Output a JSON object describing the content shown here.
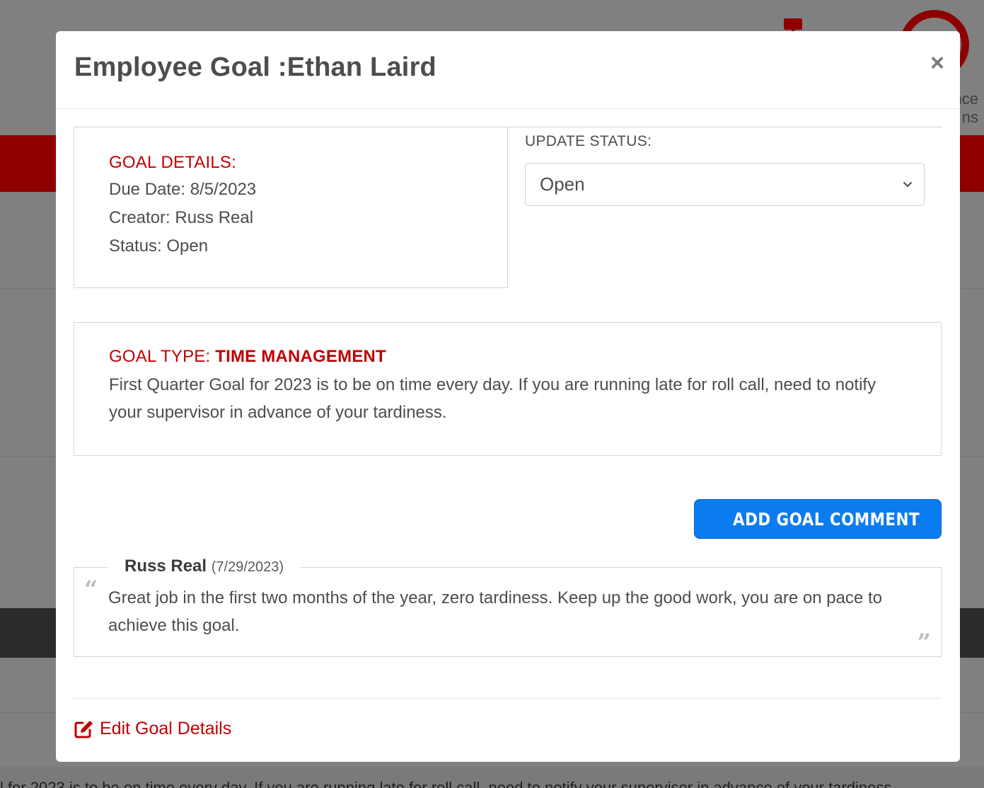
{
  "background": {
    "nav_text_line1": "nce",
    "nav_text_line2": "ns",
    "bottom_text": "l for 2023 is to be on time every day. If you are running late for roll call, need to notify your supervisor in advance of your tardiness."
  },
  "modal": {
    "title": "Employee Goal :Ethan Laird",
    "close_symbol": "×",
    "goal_details": {
      "heading": "GOAL DETAILS:",
      "due_date": "Due Date: 8/5/2023",
      "creator": "Creator: Russ Real",
      "status": "Status: Open"
    },
    "update_status": {
      "label": "UPDATE STATUS:",
      "selected": "Open"
    },
    "goal_type": {
      "label": "GOAL TYPE: ",
      "value": "TIME MANAGEMENT",
      "description": "First Quarter Goal for 2023 is to be on time every day. If you are running late for roll call, need to notify your supervisor in advance of your tardiness."
    },
    "add_comment_button": "ADD GOAL COMMENT",
    "comment": {
      "author": "Russ Real",
      "date": "(7/29/2023)",
      "text": "Great job in the first two months of the year, zero tardiness. Keep up the good work, you are on pace to achieve this goal.",
      "open_quote": "“",
      "close_quote": "”"
    },
    "edit_link": "Edit Goal Details"
  },
  "colors": {
    "accent_red": "#c00000",
    "button_blue": "#0a7cf0",
    "overlay_gray": "#808080"
  },
  "icons": [
    "close-icon",
    "chevron-down-icon",
    "comment-plus-icon",
    "quote-open-icon",
    "quote-close-icon",
    "edit-icon"
  ]
}
